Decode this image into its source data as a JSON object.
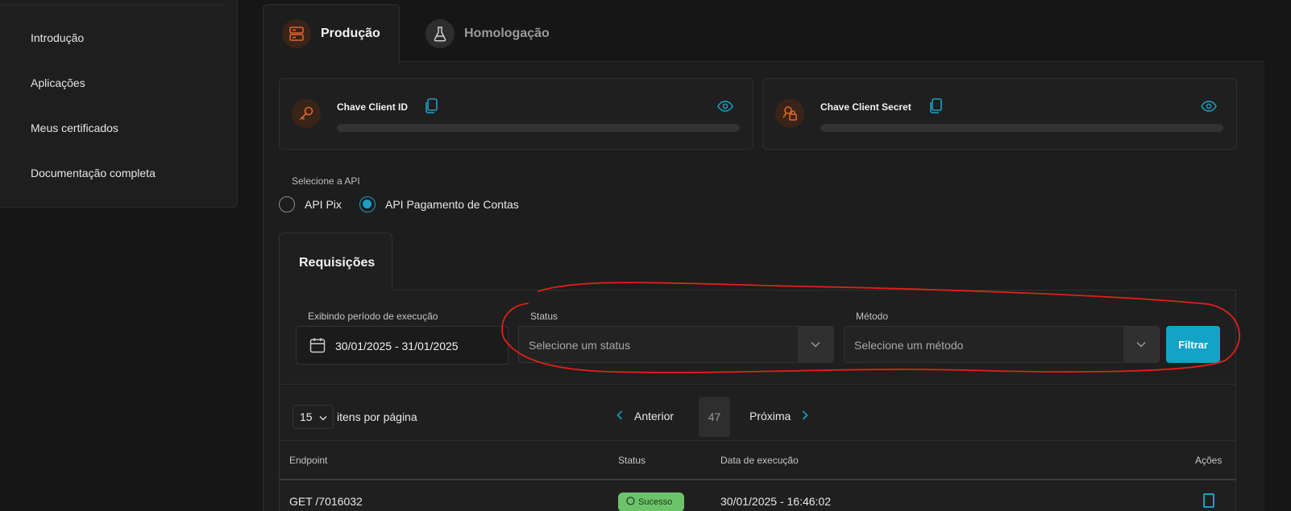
{
  "sidebar": {
    "items": [
      {
        "label": "Introdução"
      },
      {
        "label": "Aplicações"
      },
      {
        "label": "Meus certificados"
      },
      {
        "label": "Documentação completa"
      }
    ]
  },
  "tabs": [
    {
      "label": "Produção",
      "icon": "server-icon",
      "active": true
    },
    {
      "label": "Homologação",
      "icon": "flask-icon",
      "active": false
    }
  ],
  "keys": {
    "client_id": {
      "label": "Chave Client ID",
      "icon": "key-icon"
    },
    "client_secret": {
      "label": "Chave Client Secret",
      "icon": "key-lock-icon"
    }
  },
  "api_select": {
    "label": "Selecione a API",
    "options": [
      {
        "label": "API Pix",
        "checked": false
      },
      {
        "label": "API Pagamento de Contas",
        "checked": true
      }
    ]
  },
  "requests": {
    "tab_label": "Requisições",
    "filters": {
      "period_label": "Exibindo período de execução",
      "period_value": "30/01/2025 - 31/01/2025",
      "status_label": "Status",
      "status_placeholder": "Selecione um status",
      "method_label": "Método",
      "method_placeholder": "Selecione um método",
      "filter_button": "Filtrar"
    },
    "pagination": {
      "per_page": "15",
      "per_page_label": "itens por página",
      "prev": "Anterior",
      "page": "47",
      "next": "Próxima"
    },
    "table": {
      "headers": [
        "Endpoint",
        "Status",
        "Data de execução",
        "Ações"
      ],
      "rows": [
        {
          "endpoint": "GET /7016032",
          "status": "Sucesso",
          "date": "30/01/2025 - 16:46:02"
        }
      ]
    }
  },
  "colors": {
    "accent": "#13a3c6",
    "orange": "#e0652a",
    "success": "#6cc36a",
    "annotation": "#e0201a"
  }
}
